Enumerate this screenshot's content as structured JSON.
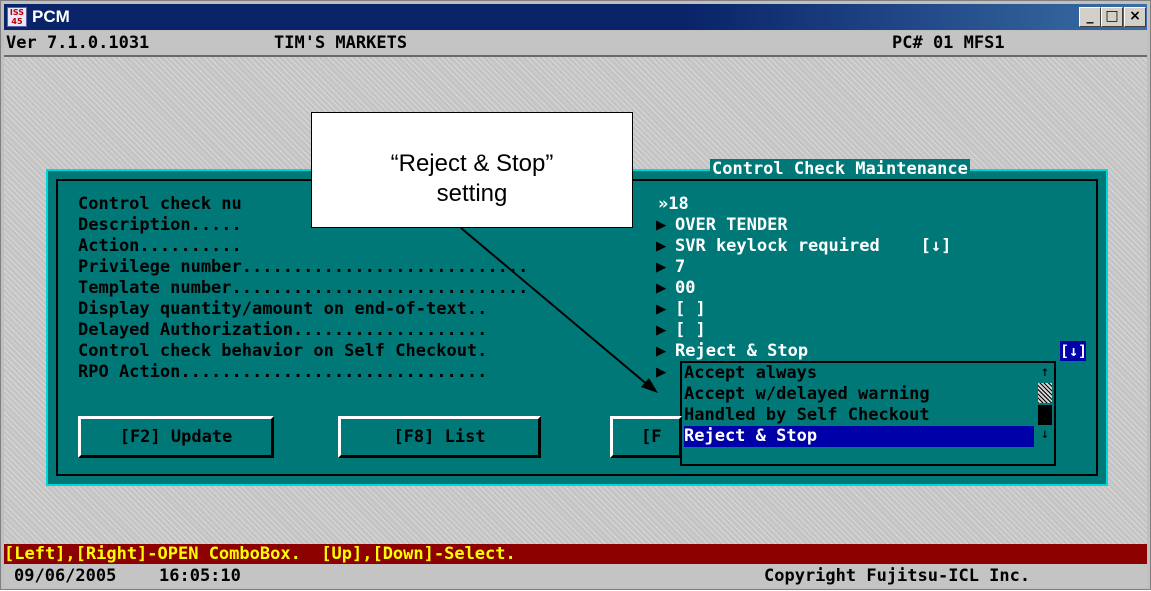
{
  "window": {
    "title": "PCM",
    "app_icon_text": "ISS 45",
    "buttons": {
      "minimize": "_",
      "maximize": "□",
      "close": "×"
    }
  },
  "header": {
    "version": "Ver 7.1.0.1031",
    "store": "TIM'S MARKETS",
    "pc": "PC# 01 MFS1"
  },
  "panel": {
    "title": "Control Check Maintenance",
    "fields": [
      {
        "label": "Control check nu",
        "value": "»18",
        "arrow": "▶"
      },
      {
        "label": "Description.....",
        "value": "OVER TENDER",
        "arrow": "▶"
      },
      {
        "label": "Action..........",
        "value": "SVR keylock required    [↓]",
        "arrow": "▶"
      },
      {
        "label": "Privilege number............................",
        "value": "7",
        "arrow": "▶"
      },
      {
        "label": "Template number.............................",
        "value": "00",
        "arrow": "▶"
      },
      {
        "label": "Display quantity/amount on end-of-text..",
        "value": "[ ]",
        "arrow": "▶"
      },
      {
        "label": "Delayed Authorization...................",
        "value": "[ ]",
        "arrow": "▶"
      },
      {
        "label": "Control check behavior on Self Checkout.",
        "value": "Reject & Stop",
        "arrow": "▶"
      },
      {
        "label": "RPO Action..............................",
        "value": "",
        "arrow": "▶"
      }
    ],
    "combo_button": "[↓]",
    "dropdown_options": [
      "Accept always",
      "Accept w/delayed warning",
      "Handled by Self Checkout",
      "Reject & Stop"
    ],
    "dropdown_selected": "Reject & Stop",
    "buttons": {
      "update": "[F2] Update",
      "list": "[F8] List",
      "third": "[F"
    }
  },
  "callout": {
    "line1": "“Reject & Stop”",
    "line2": "setting"
  },
  "hint": "[Left],[Right]-OPEN ComboBox.  [Up],[Down]-Select.",
  "footer": {
    "date": "09/06/2005",
    "time": "16:05:10",
    "copyright": "Copyright Fujitsu-ICL Inc."
  }
}
